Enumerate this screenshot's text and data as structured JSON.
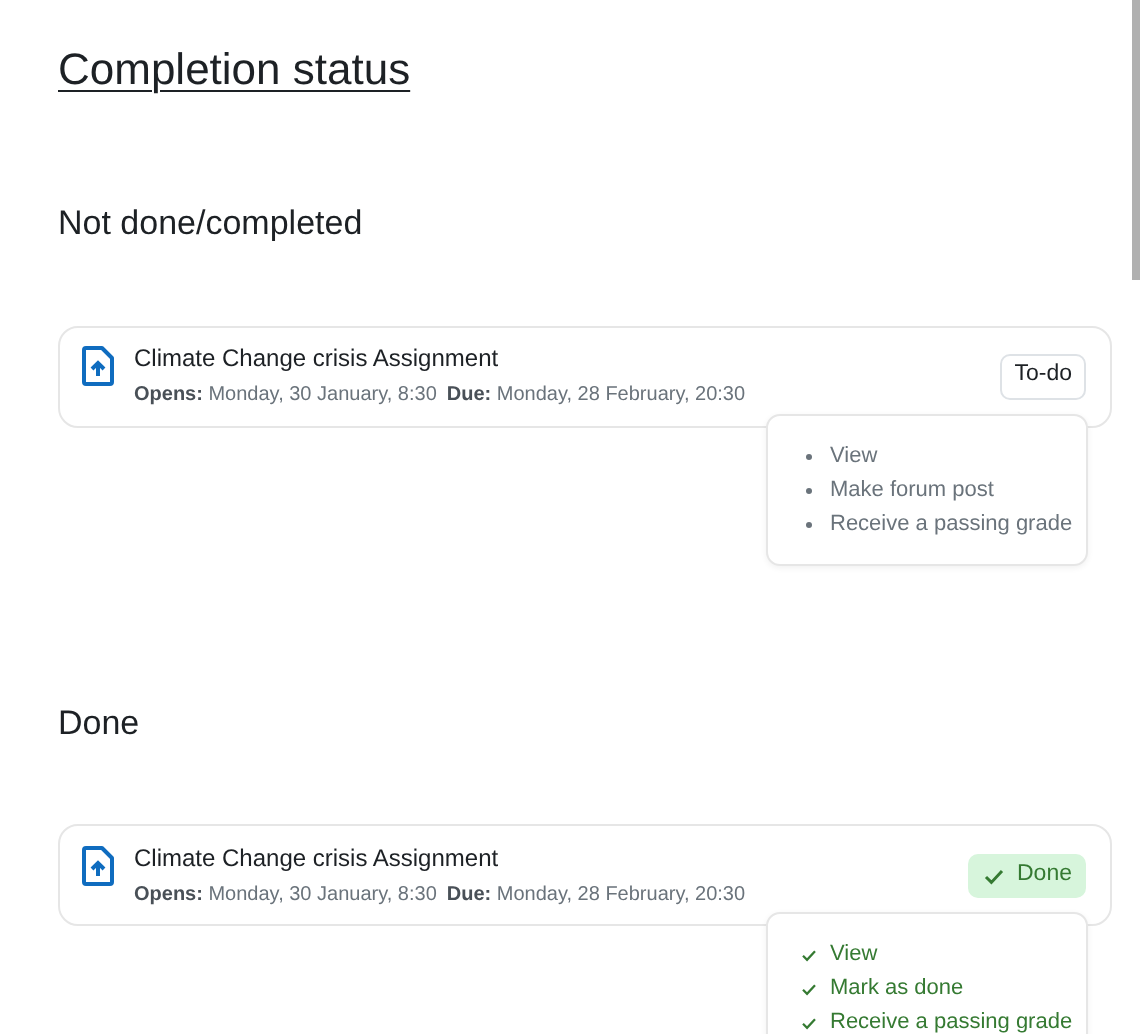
{
  "title": "Completion status",
  "sections": [
    {
      "heading": "Not done/completed",
      "activity": {
        "name": "Climate Change crisis Assignment",
        "opens_label": "Opens:",
        "opens": "Monday, 30 January, 8:30",
        "due_label": "Due:",
        "due": "Monday, 28 February, 20:30",
        "status": {
          "kind": "todo",
          "label": "To-do"
        },
        "conditions": [
          {
            "label": "View",
            "done": false
          },
          {
            "label": "Make forum post",
            "done": false
          },
          {
            "label": "Receive a passing grade",
            "done": false
          }
        ]
      }
    },
    {
      "heading": "Done",
      "activity": {
        "name": "Climate Change crisis Assignment",
        "opens_label": "Opens:",
        "opens": "Monday, 30 January, 8:30",
        "due_label": "Due:",
        "due": "Monday, 28 February, 20:30",
        "status": {
          "kind": "done",
          "label": "Done"
        },
        "conditions": [
          {
            "label": "View",
            "done": true
          },
          {
            "label": "Mark as done",
            "done": true
          },
          {
            "label": "Receive a passing grade",
            "done": true
          }
        ]
      }
    }
  ]
}
